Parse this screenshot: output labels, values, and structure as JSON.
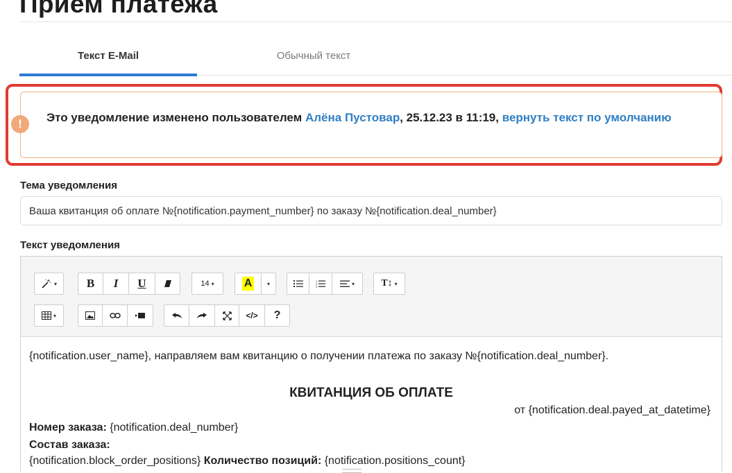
{
  "page": {
    "title": "Прием платежа"
  },
  "tabs": {
    "email": "Текст E-Mail",
    "plain": "Обычный текст"
  },
  "notice": {
    "icon": "!",
    "prefix": "Это уведомление изменено пользователем ",
    "user": "Алёна Пустовар",
    "middle": ", 25.12.23 в 11:19, ",
    "reset_link": "вернуть текст по умолчанию"
  },
  "subject": {
    "label": "Тема уведомления",
    "value": "Ваша квитанция об оплате №{notification.payment_number} по заказу №{notification.deal_number}"
  },
  "body": {
    "label": "Текст уведомления",
    "toolbar": {
      "font_size": "14",
      "color_letter": "A",
      "help": "?"
    },
    "content": {
      "greeting": "{notification.user_name}, направляем вам квитанцию о получении платежа по заказу №{notification.deal_number}.",
      "heading": "КВИТАНЦИЯ ОБ ОПЛАТЕ",
      "date_line": "от {notification.deal.payed_at_datetime}",
      "order_label": "Номер заказа:",
      "order_value": " {notification.deal_number}",
      "composition_label": "Состав заказа:",
      "positions_block": "{notification.block_order_positions} ",
      "count_label": "Количество позиций:",
      "count_value": " {notification.positions_count}"
    }
  }
}
